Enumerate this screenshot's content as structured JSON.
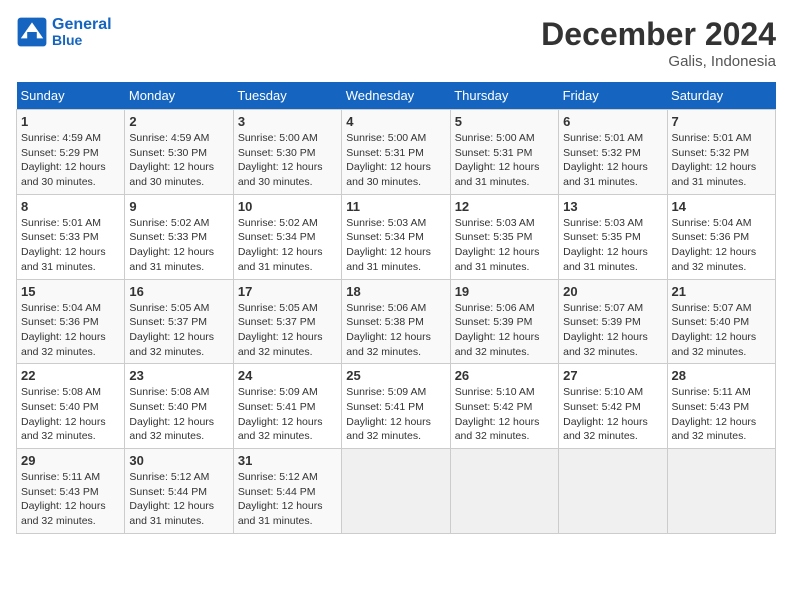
{
  "header": {
    "logo_line1": "General",
    "logo_line2": "Blue",
    "month_title": "December 2024",
    "location": "Galis, Indonesia"
  },
  "days_of_week": [
    "Sunday",
    "Monday",
    "Tuesday",
    "Wednesday",
    "Thursday",
    "Friday",
    "Saturday"
  ],
  "weeks": [
    [
      {
        "day": "1",
        "info": "Sunrise: 4:59 AM\nSunset: 5:29 PM\nDaylight: 12 hours\nand 30 minutes."
      },
      {
        "day": "2",
        "info": "Sunrise: 4:59 AM\nSunset: 5:30 PM\nDaylight: 12 hours\nand 30 minutes."
      },
      {
        "day": "3",
        "info": "Sunrise: 5:00 AM\nSunset: 5:30 PM\nDaylight: 12 hours\nand 30 minutes."
      },
      {
        "day": "4",
        "info": "Sunrise: 5:00 AM\nSunset: 5:31 PM\nDaylight: 12 hours\nand 30 minutes."
      },
      {
        "day": "5",
        "info": "Sunrise: 5:00 AM\nSunset: 5:31 PM\nDaylight: 12 hours\nand 31 minutes."
      },
      {
        "day": "6",
        "info": "Sunrise: 5:01 AM\nSunset: 5:32 PM\nDaylight: 12 hours\nand 31 minutes."
      },
      {
        "day": "7",
        "info": "Sunrise: 5:01 AM\nSunset: 5:32 PM\nDaylight: 12 hours\nand 31 minutes."
      }
    ],
    [
      {
        "day": "8",
        "info": "Sunrise: 5:01 AM\nSunset: 5:33 PM\nDaylight: 12 hours\nand 31 minutes."
      },
      {
        "day": "9",
        "info": "Sunrise: 5:02 AM\nSunset: 5:33 PM\nDaylight: 12 hours\nand 31 minutes."
      },
      {
        "day": "10",
        "info": "Sunrise: 5:02 AM\nSunset: 5:34 PM\nDaylight: 12 hours\nand 31 minutes."
      },
      {
        "day": "11",
        "info": "Sunrise: 5:03 AM\nSunset: 5:34 PM\nDaylight: 12 hours\nand 31 minutes."
      },
      {
        "day": "12",
        "info": "Sunrise: 5:03 AM\nSunset: 5:35 PM\nDaylight: 12 hours\nand 31 minutes."
      },
      {
        "day": "13",
        "info": "Sunrise: 5:03 AM\nSunset: 5:35 PM\nDaylight: 12 hours\nand 31 minutes."
      },
      {
        "day": "14",
        "info": "Sunrise: 5:04 AM\nSunset: 5:36 PM\nDaylight: 12 hours\nand 32 minutes."
      }
    ],
    [
      {
        "day": "15",
        "info": "Sunrise: 5:04 AM\nSunset: 5:36 PM\nDaylight: 12 hours\nand 32 minutes."
      },
      {
        "day": "16",
        "info": "Sunrise: 5:05 AM\nSunset: 5:37 PM\nDaylight: 12 hours\nand 32 minutes."
      },
      {
        "day": "17",
        "info": "Sunrise: 5:05 AM\nSunset: 5:37 PM\nDaylight: 12 hours\nand 32 minutes."
      },
      {
        "day": "18",
        "info": "Sunrise: 5:06 AM\nSunset: 5:38 PM\nDaylight: 12 hours\nand 32 minutes."
      },
      {
        "day": "19",
        "info": "Sunrise: 5:06 AM\nSunset: 5:39 PM\nDaylight: 12 hours\nand 32 minutes."
      },
      {
        "day": "20",
        "info": "Sunrise: 5:07 AM\nSunset: 5:39 PM\nDaylight: 12 hours\nand 32 minutes."
      },
      {
        "day": "21",
        "info": "Sunrise: 5:07 AM\nSunset: 5:40 PM\nDaylight: 12 hours\nand 32 minutes."
      }
    ],
    [
      {
        "day": "22",
        "info": "Sunrise: 5:08 AM\nSunset: 5:40 PM\nDaylight: 12 hours\nand 32 minutes."
      },
      {
        "day": "23",
        "info": "Sunrise: 5:08 AM\nSunset: 5:40 PM\nDaylight: 12 hours\nand 32 minutes."
      },
      {
        "day": "24",
        "info": "Sunrise: 5:09 AM\nSunset: 5:41 PM\nDaylight: 12 hours\nand 32 minutes."
      },
      {
        "day": "25",
        "info": "Sunrise: 5:09 AM\nSunset: 5:41 PM\nDaylight: 12 hours\nand 32 minutes."
      },
      {
        "day": "26",
        "info": "Sunrise: 5:10 AM\nSunset: 5:42 PM\nDaylight: 12 hours\nand 32 minutes."
      },
      {
        "day": "27",
        "info": "Sunrise: 5:10 AM\nSunset: 5:42 PM\nDaylight: 12 hours\nand 32 minutes."
      },
      {
        "day": "28",
        "info": "Sunrise: 5:11 AM\nSunset: 5:43 PM\nDaylight: 12 hours\nand 32 minutes."
      }
    ],
    [
      {
        "day": "29",
        "info": "Sunrise: 5:11 AM\nSunset: 5:43 PM\nDaylight: 12 hours\nand 32 minutes."
      },
      {
        "day": "30",
        "info": "Sunrise: 5:12 AM\nSunset: 5:44 PM\nDaylight: 12 hours\nand 31 minutes."
      },
      {
        "day": "31",
        "info": "Sunrise: 5:12 AM\nSunset: 5:44 PM\nDaylight: 12 hours\nand 31 minutes."
      },
      {
        "day": "",
        "info": ""
      },
      {
        "day": "",
        "info": ""
      },
      {
        "day": "",
        "info": ""
      },
      {
        "day": "",
        "info": ""
      }
    ]
  ]
}
